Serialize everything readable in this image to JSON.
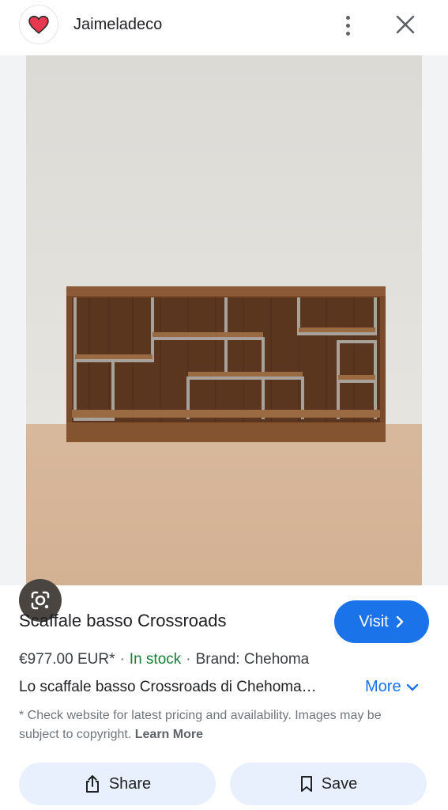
{
  "header": {
    "site_name": "Jaimeladeco",
    "logo_icon": "heart-icon",
    "logo_color": "#e8384f",
    "menu_icon": "more-vert-icon",
    "close_icon": "close-icon"
  },
  "image": {
    "lens_icon": "google-lens-icon"
  },
  "product": {
    "title": "Scaffale basso Crossroads",
    "visit_label": "Visit",
    "price": "€977.00 EUR*",
    "stock": "In stock",
    "brand": "Brand: Chehoma",
    "description": "Lo scaffale basso Crossroads di Chehoma…",
    "more_label": "More",
    "disclaimer": "* Check website for latest pricing and availability. Images may be subject to copyright.",
    "learn_more": "Learn More"
  },
  "actions": {
    "share_label": "Share",
    "save_label": "Save"
  },
  "colors": {
    "accent": "#1a73e8",
    "stock_green": "#188038",
    "pill_bg": "#e8f0fe"
  }
}
